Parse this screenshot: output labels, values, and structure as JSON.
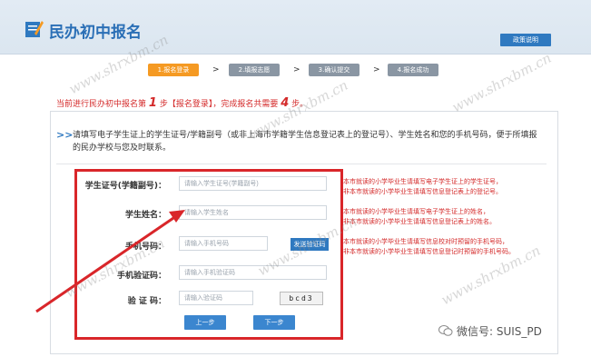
{
  "header": {
    "title": "民办初中报名",
    "policy_button": "政策说明"
  },
  "steps": [
    {
      "label": "1.报名登录",
      "active": true
    },
    {
      "label": "2.填报志愿",
      "active": false
    },
    {
      "label": "3.确认提交",
      "active": false
    },
    {
      "label": "4.报名成功",
      "active": false
    }
  ],
  "step_arrow": ">",
  "progress": {
    "prefix": "当前进行民办初中报名第",
    "current": "1",
    "middle": "步【报名登录】，完成报名共需要",
    "total": "4",
    "suffix": "步。"
  },
  "notice": {
    "chevron": ">>",
    "text": "请填写电子学生证上的学生证号/学籍副号（或非上海市学籍学生信息登记表上的登记号）、学生姓名和您的手机号码，便于所填报的民办学校与您及时联系。"
  },
  "form": {
    "student_id_label": "学生证号(学籍副号)：",
    "student_id_placeholder": "请输入学生证号(学籍副号)",
    "name_label": "学生姓名：",
    "name_placeholder": "请输入学生姓名",
    "phone_label": "手机号码：",
    "phone_placeholder": "请输入手机号码",
    "sms_button": "发送验证码",
    "sms_code_label": "手机验证码：",
    "sms_code_placeholder": "请输入手机验证码",
    "captcha_label": "验 证 码：",
    "captcha_placeholder": "请输入验证码",
    "captcha_image_text": "bcd3",
    "prev_button": "上一步",
    "next_button": "下一步"
  },
  "hints": {
    "student_id_1": "本市就读的小学毕业生请填写电子学生证上的学生证号，",
    "student_id_2": "非本市就读的小学毕业生请填写信息登记表上的登记号。",
    "name_1": "本市就读的小学毕业生请填写电子学生证上的姓名，",
    "name_2": "非本市就读的小学毕业生请填写信息登记表上的姓名。",
    "phone_1": "本市就读的小学毕业生请填写信息校对时预留的手机号码，",
    "phone_2": "非本市就读的小学毕业生请填写信息登记时预留的手机号码。"
  },
  "watermark": "www.shrxbm.cn",
  "wechat": "微信号: SUIS_PD",
  "colors": {
    "brand_blue": "#2f79c0",
    "active_step": "#f59a23",
    "alert_red": "#d42a2a",
    "highlight_red": "#d9262a"
  }
}
